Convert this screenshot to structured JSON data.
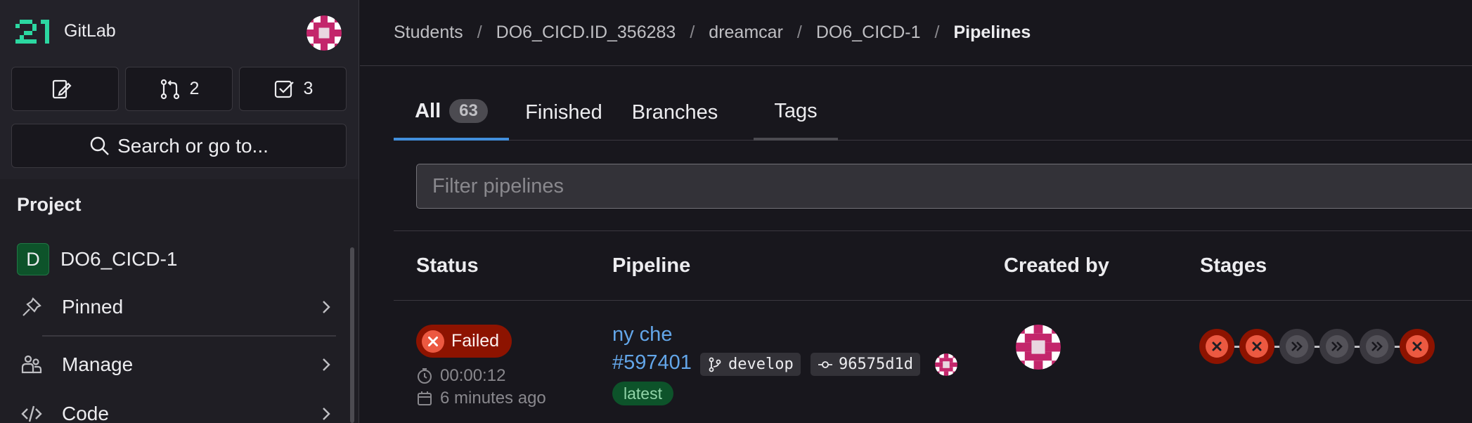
{
  "app": {
    "brand": "GitLab"
  },
  "sidebar": {
    "buttons": [
      {
        "icon": "issues-edit-icon",
        "label": ""
      },
      {
        "icon": "merge-request-icon",
        "label": "2"
      },
      {
        "icon": "todo-check-icon",
        "label": "3"
      }
    ],
    "search_label": "Search or go to...",
    "section_title": "Project",
    "items": [
      {
        "label": "DO6_CICD-1",
        "badge": "D"
      },
      {
        "label": "Pinned",
        "icon": "thumbtack-icon"
      },
      {
        "label": "Manage",
        "icon": "users-icon"
      },
      {
        "label": "Code",
        "icon": "code-icon"
      }
    ]
  },
  "breadcrumb": {
    "items": [
      "Students",
      "DO6_CICD.ID_356283",
      "dreamcar",
      "DO6_CICD-1"
    ],
    "current": "Pipelines"
  },
  "tabs": [
    {
      "label": "All",
      "count": "63",
      "active": true
    },
    {
      "label": "Finished"
    },
    {
      "label": "Branches"
    },
    {
      "label": "Tags"
    }
  ],
  "filter": {
    "placeholder": "Filter pipelines"
  },
  "table": {
    "headers": [
      "Status",
      "Pipeline",
      "Created by",
      "Stages"
    ],
    "rows": [
      {
        "status": "Failed",
        "duration": "00:00:12",
        "created": "6 minutes ago",
        "title": "ny che",
        "id": "#597401",
        "branch": "develop",
        "commit": "96575d1d",
        "tag": "latest",
        "stages": [
          "failed",
          "failed",
          "skipped",
          "skipped",
          "skipped",
          "failed"
        ]
      }
    ]
  },
  "colors": {
    "accent": "#428fdc",
    "link": "#63a6e9",
    "failed": "#8d1300",
    "failed_icon": "#ec5941",
    "success_badge": "#0d532a",
    "logo": "#2cd8a1",
    "avatar": "#c3266b"
  }
}
